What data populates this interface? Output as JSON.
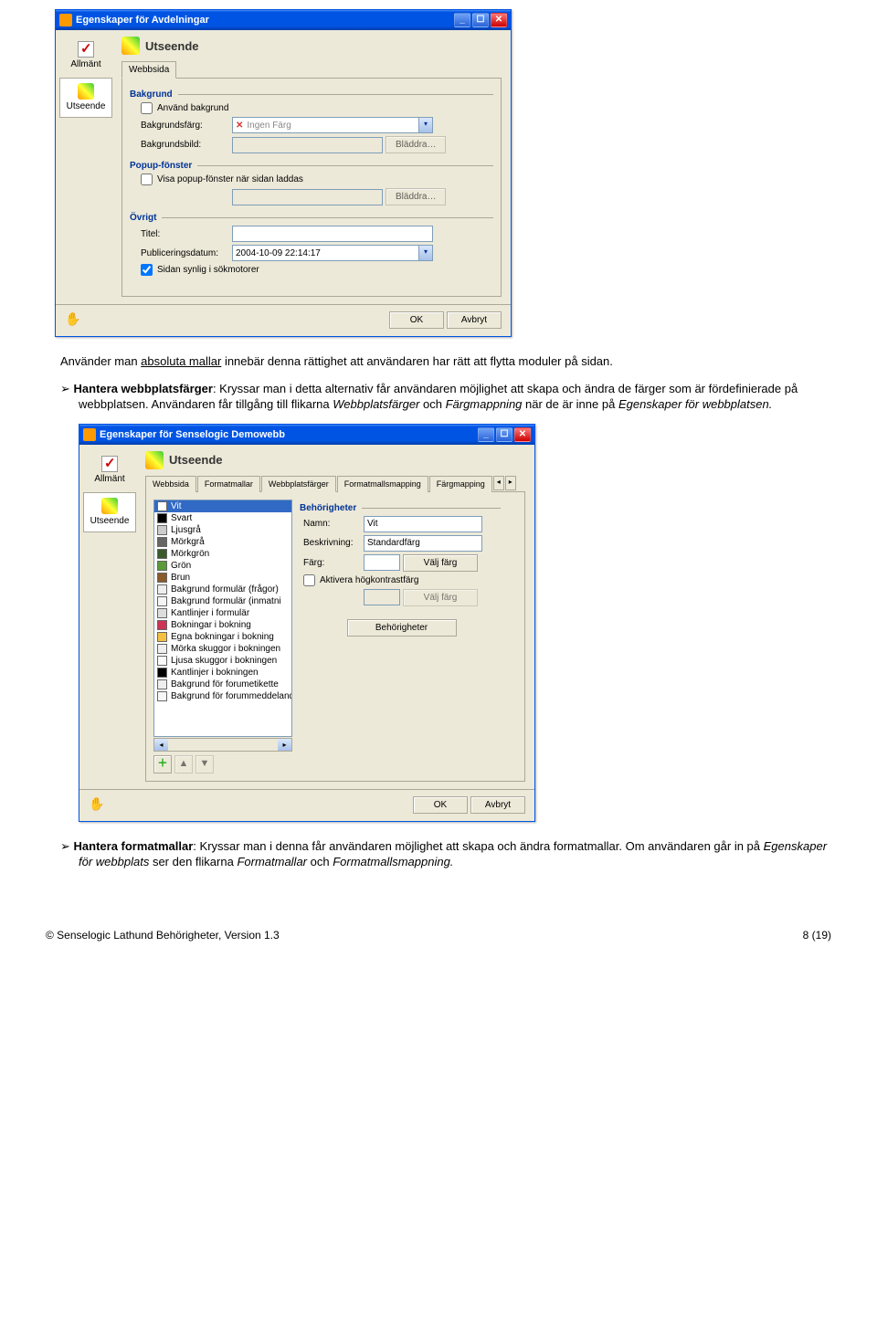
{
  "dlg1": {
    "title": "Egenskaper för Avdelningar",
    "nav": {
      "item1": "Allmänt",
      "item2": "Utseende"
    },
    "paneTitle": "Utseende",
    "tabs": {
      "webbsida": "Webbsida"
    },
    "groups": {
      "bakgrund": "Bakgrund",
      "popup": "Popup-fönster",
      "ovrigt": "Övrigt"
    },
    "fields": {
      "anvandBakgrund": "Använd bakgrund",
      "bakgrundsfarg": "Bakgrundsfärg:",
      "ingenFarg": "Ingen Färg",
      "bakgrundsbild": "Bakgrundsbild:",
      "bladdra": "Bläddra…",
      "visaPopup": "Visa popup-fönster när sidan laddas",
      "titel": "Titel:",
      "pubdatum": "Publiceringsdatum:",
      "pubdatumVal": "2004-10-09 22:14:17",
      "sokmotor": "Sidan synlig i sökmotorer"
    },
    "buttons": {
      "ok": "OK",
      "avbryt": "Avbryt"
    }
  },
  "para1": {
    "pre": "Använder man ",
    "u": "absoluta mallar",
    "post": " innebär denna rättighet att användaren har rätt att flytta moduler på sidan."
  },
  "para2": {
    "lead": "Hantera webbplatsfärger",
    "rest": ": Kryssar man i detta alternativ får användaren möjlighet att skapa och ändra de färger som är fördefinierade på webbplatsen. Användaren får tillgång till flikarna ",
    "i1": "Webbplatsfärger",
    "mid": " och ",
    "i2": "Färgmappning",
    "tail": " när de är inne på ",
    "i3": "Egenskaper för webbplatsen."
  },
  "dlg2": {
    "title": "Egenskaper för Senselogic Demowebb",
    "nav": {
      "item1": "Allmänt",
      "item2": "Utseende"
    },
    "paneTitle": "Utseende",
    "tabs": {
      "t1": "Webbsida",
      "t2": "Formatmallar",
      "t3": "Webbplatsfärger",
      "t4": "Formatmallsmapping",
      "t5": "Färgmapping"
    },
    "colors": [
      {
        "name": "Vit",
        "c": "#ffffff",
        "sel": true
      },
      {
        "name": "Svart",
        "c": "#000000"
      },
      {
        "name": "Ljusgrå",
        "c": "#cccccc"
      },
      {
        "name": "Mörkgrå",
        "c": "#666666"
      },
      {
        "name": "Mörkgrön",
        "c": "#3a5a2a"
      },
      {
        "name": "Grön",
        "c": "#5a9a3a"
      },
      {
        "name": "Brun",
        "c": "#8a5a2a"
      },
      {
        "name": "Bakgrund formulär (frågor)",
        "c": "#eeeeee"
      },
      {
        "name": "Bakgrund formulär (inmatni",
        "c": "#f5f5f5"
      },
      {
        "name": "Kantlinjer i formulär",
        "c": "#dddddd"
      },
      {
        "name": "Bokningar i bokning",
        "c": "#cc3355"
      },
      {
        "name": "Egna bokningar i bokning",
        "c": "#f5c042"
      },
      {
        "name": "Mörka skuggor i bokningen",
        "c": "#efefef"
      },
      {
        "name": "Ljusa skuggor i bokningen",
        "c": "#fafafa"
      },
      {
        "name": "Kantlinjer i bokningen",
        "c": "#000000"
      },
      {
        "name": "Bakgrund för forumetikette",
        "c": "#eeeeee"
      },
      {
        "name": "Bakgrund för forummeddelanden",
        "c": "#f7f7f7"
      }
    ],
    "right": {
      "group": "Behörigheter",
      "namn": "Namn:",
      "namnVal": "Vit",
      "beskr": "Beskrivning:",
      "beskrVal": "Standardfärg",
      "farg": "Färg:",
      "valjFarg": "Välj färg",
      "aktivera": "Aktivera högkontrastfärg",
      "behor": "Behörigheter"
    },
    "buttons": {
      "ok": "OK",
      "avbryt": "Avbryt"
    }
  },
  "para3": {
    "lead": "Hantera formatmallar",
    "rest": ": Kryssar man i denna får användaren möjlighet att skapa och ändra formatmallar. Om användaren går in på ",
    "i1": "Egenskaper för webbplats",
    "mid": " ser den flikarna ",
    "i2": "Formatmallar",
    "and": " och ",
    "i3": "Formatmallsmappning."
  },
  "footer": {
    "left": "© Senselogic Lathund Behörigheter, Version 1.3",
    "right": "8 (19)"
  }
}
